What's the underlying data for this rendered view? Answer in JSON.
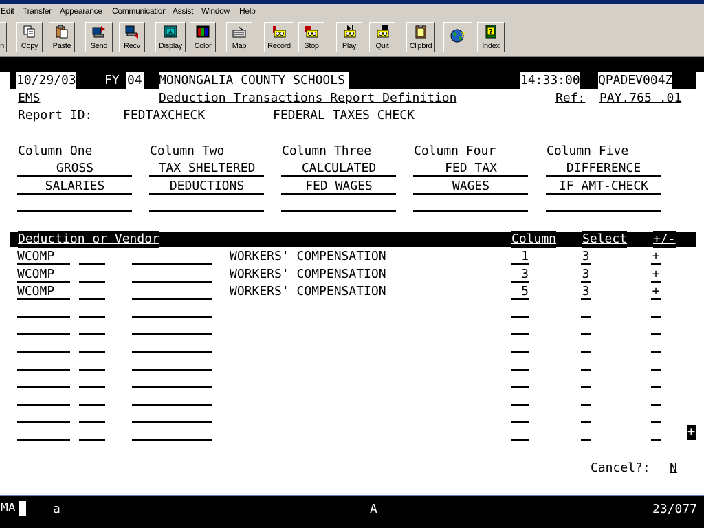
{
  "menu": [
    "Edit",
    "Transfer",
    "Appearance",
    "Communication",
    "Assist",
    "Window",
    "Help"
  ],
  "toolbar": [
    "n",
    "Copy",
    "Paste",
    "Send",
    "Recv",
    "Display",
    "Color",
    "Map",
    "Record",
    "Stop",
    "Play",
    "Quit",
    "Clipbrd",
    "",
    "Index"
  ],
  "header": {
    "date": "10/29/03",
    "fy_label": "FY",
    "fy": "04",
    "org": "MONONGALIA COUNTY SCHOOLS",
    "time": "14:33:00",
    "terminal": "QPADEV004Z",
    "system": "EMS",
    "title": "Deduction Transactions Report Definition",
    "ref_label": "Ref:",
    "ref": "PAY.765 .01"
  },
  "report": {
    "id_label": "Report ID:",
    "id": "FEDTAXCHECK",
    "description": "FEDERAL TAXES CHECK"
  },
  "columns": {
    "labels": [
      "Column One",
      "Column Two",
      "Column Three",
      "Column Four",
      "Column Five"
    ],
    "line1": [
      "GROSS",
      "TAX SHELTERED",
      "CALCULATED",
      "FED TAX",
      "DIFFERENCE"
    ],
    "line2": [
      "SALARIES",
      "DEDUCTIONS",
      "FED WAGES",
      "WAGES",
      "IF AMT-CHECK"
    ]
  },
  "grid": {
    "headers": {
      "deduction": "Deduction or Vendor",
      "column": "Column",
      "select": "Select",
      "sign": "+/-"
    },
    "rows": [
      {
        "code": "WCOMP",
        "description": "WORKERS' COMPENSATION",
        "column": "1",
        "select": "3",
        "sign": "+"
      },
      {
        "code": "WCOMP",
        "description": "WORKERS' COMPENSATION",
        "column": "3",
        "select": "3",
        "sign": "+"
      },
      {
        "code": "WCOMP",
        "description": "WORKERS' COMPENSATION",
        "column": "5",
        "select": "3",
        "sign": "+"
      }
    ],
    "empty_rows": 8,
    "more_indicator": "+"
  },
  "cancel": {
    "label": "Cancel?:",
    "value": "N"
  },
  "status": {
    "mode": "MA",
    "left_char": "a",
    "center_char": "A",
    "position": "23/077"
  }
}
